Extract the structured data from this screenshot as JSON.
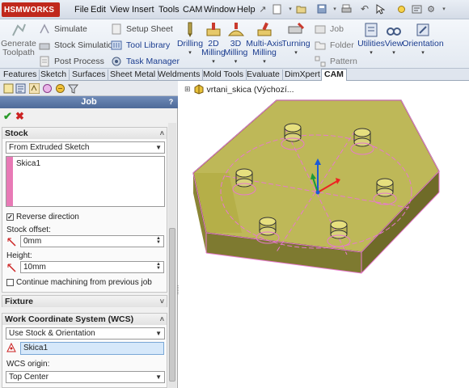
{
  "app": {
    "logo": "HSMWORKS",
    "logo_prefix": "HSM",
    "logo_suffix": "WORKS",
    "menu": [
      "File",
      "Edit",
      "View",
      "Insert",
      "Tools",
      "CAM",
      "Window",
      "Help"
    ]
  },
  "ribbon": {
    "generate": "Generate\nToolpath",
    "small_col1": [
      "Simulate",
      "Stock Simulation",
      "Post Process"
    ],
    "small_col2": [
      "Setup Sheet",
      "Tool Library",
      "Task Manager"
    ],
    "big": [
      "Drilling",
      "2D\nMilling",
      "3D\nMilling",
      "Multi-Axis\nMilling",
      "Turning"
    ],
    "small_col3": [
      "Job",
      "Folder",
      "Pattern"
    ],
    "big2": [
      "Utilities",
      "View",
      "Orientation"
    ]
  },
  "tabs": [
    "Features",
    "Sketch",
    "Surfaces",
    "Sheet Metal",
    "Weldments",
    "Mold Tools",
    "Evaluate",
    "DimXpert",
    "CAM"
  ],
  "active_tab": "CAM",
  "panel": {
    "title": "Job",
    "help": "?",
    "stock": {
      "header": "Stock",
      "mode": "From Extruded Sketch",
      "selection": "Skica1",
      "reverse_label": "Reverse direction",
      "reverse_checked": true,
      "offset_label": "Stock offset:",
      "offset_value": "0mm",
      "height_label": "Height:",
      "height_value": "10mm",
      "continue_label": "Continue machining from previous job",
      "continue_checked": false
    },
    "fixture": {
      "header": "Fixture"
    },
    "wcs": {
      "header": "Work Coordinate System (WCS)",
      "mode": "Use Stock & Orientation",
      "selection": "Skica1",
      "origin_label": "WCS origin:",
      "origin_value": "Top Center"
    }
  },
  "tree": {
    "root": "vrtani_skica  (Výchozí..."
  },
  "colors": {
    "accent": "#4e6a99",
    "stock_fill": "#b7b04a",
    "stock_edge": "#e879d0"
  }
}
